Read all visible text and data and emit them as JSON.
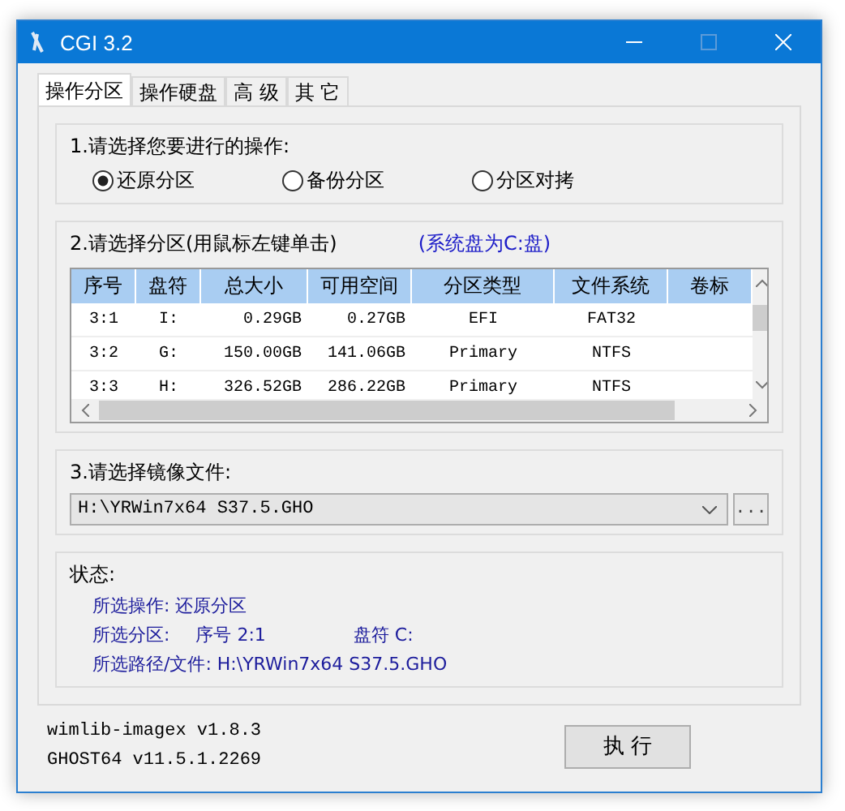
{
  "window": {
    "title": "CGI 3.2"
  },
  "tabs": [
    {
      "label": "操作分区",
      "selected": true
    },
    {
      "label": "操作硬盘",
      "selected": false
    },
    {
      "label": "高 级",
      "selected": false
    },
    {
      "label": "其 它",
      "selected": false
    }
  ],
  "operation": {
    "label": "1.请选择您要进行的操作:",
    "options": [
      {
        "label": "还原分区",
        "selected": true
      },
      {
        "label": "备份分区",
        "selected": false
      },
      {
        "label": "分区对拷",
        "selected": false
      }
    ]
  },
  "partitions": {
    "label": "2.请选择分区(用鼠标左键单击)",
    "note": "(系统盘为C:盘)",
    "columns": [
      "序号",
      "盘符",
      "总大小",
      "可用空间",
      "分区类型",
      "文件系统",
      "卷标"
    ],
    "rows": [
      [
        "3:1",
        "I:",
        "0.29GB",
        "0.27GB",
        "EFI",
        "FAT32",
        ""
      ],
      [
        "3:2",
        "G:",
        "150.00GB",
        "141.06GB",
        "Primary",
        "NTFS",
        ""
      ],
      [
        "3:3",
        "H:",
        "326.52GB",
        "286.22GB",
        "Primary",
        "NTFS",
        ""
      ]
    ]
  },
  "image_file": {
    "label": "3.请选择镜像文件:",
    "value": "H:\\YRWin7x64 S37.5.GHO",
    "browse": "..."
  },
  "status": {
    "label": "状态:",
    "operation": "所选操作: 还原分区",
    "partition_label": "所选分区:",
    "index": "序号 2:1",
    "drive": "盘符 C:",
    "path": "所选路径/文件: H:\\YRWin7x64 S37.5.GHO"
  },
  "versions": [
    "wimlib-imagex v1.8.3",
    "GHOST64 v11.5.1.2269"
  ],
  "buttons": [
    "执 行"
  ]
}
